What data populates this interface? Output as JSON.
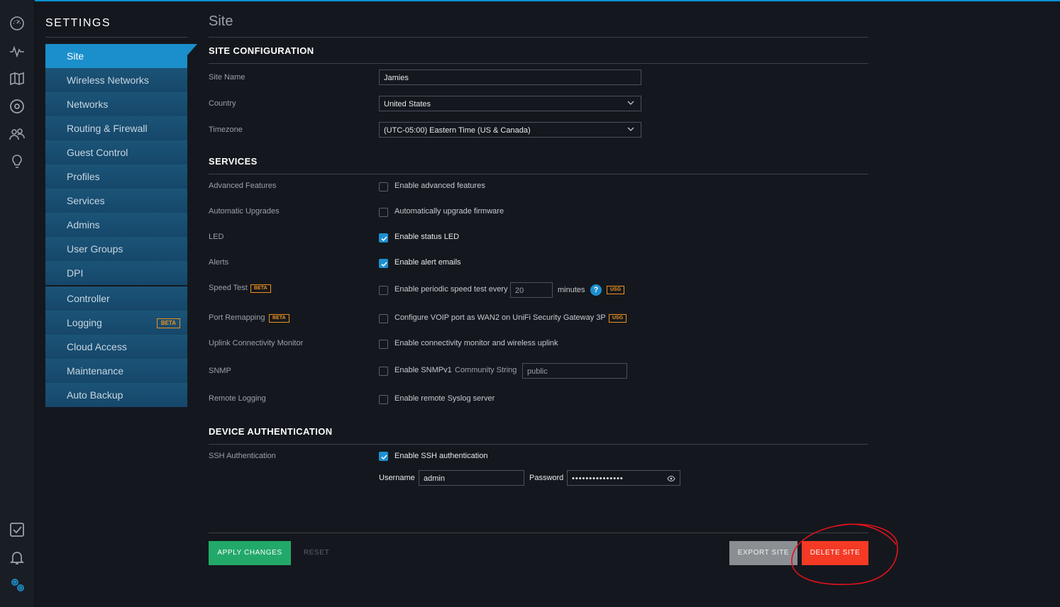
{
  "colors": {
    "accent": "#1a8fcb",
    "apply": "#22a96a",
    "delete": "#f43a25",
    "export": "#8b8e93",
    "beta": "#f0901e"
  },
  "rail": {
    "top_icons": [
      "dashboard-icon",
      "statistics-icon",
      "map-icon",
      "devices-icon",
      "clients-icon",
      "insights-icon"
    ],
    "bottom_icons": [
      "tasks-icon",
      "alerts-bell-icon",
      "settings-gears-icon"
    ]
  },
  "sidebar": {
    "title": "SETTINGS",
    "items": [
      {
        "label": "Site"
      },
      {
        "label": "Wireless Networks"
      },
      {
        "label": "Networks"
      },
      {
        "label": "Routing & Firewall"
      },
      {
        "label": "Guest Control"
      },
      {
        "label": "Profiles"
      },
      {
        "label": "Services"
      },
      {
        "label": "Admins"
      },
      {
        "label": "User Groups"
      },
      {
        "label": "DPI"
      }
    ],
    "items2": [
      {
        "label": "Controller"
      },
      {
        "label": "Logging",
        "badge": "BETA"
      },
      {
        "label": "Cloud Access"
      },
      {
        "label": "Maintenance"
      },
      {
        "label": "Auto Backup"
      }
    ]
  },
  "main": {
    "title": "Site",
    "site_config": {
      "heading": "SITE CONFIGURATION",
      "site_name_label": "Site Name",
      "site_name_value": "Jamies",
      "country_label": "Country",
      "country_value": "United States",
      "timezone_label": "Timezone",
      "timezone_value": "(UTC-05:00) Eastern Time (US & Canada)"
    },
    "services": {
      "heading": "SERVICES",
      "advanced_label": "Advanced Features",
      "advanced_opt": "Enable advanced features",
      "upgrades_label": "Automatic Upgrades",
      "upgrades_opt": "Automatically upgrade firmware",
      "led_label": "LED",
      "led_opt": "Enable status LED",
      "alerts_label": "Alerts",
      "alerts_opt": "Enable alert emails",
      "speed_label": "Speed Test",
      "speed_badge": "BETA",
      "speed_opt": "Enable periodic speed test every",
      "speed_value": "20",
      "speed_unit": "minutes",
      "help_glyph": "?",
      "usg_badge": "USG",
      "port_label": "Port Remapping",
      "port_badge": "BETA",
      "port_opt": "Configure VOIP port as WAN2 on UniFi Security Gateway 3P",
      "uplink_label": "Uplink Connectivity Monitor",
      "uplink_opt": "Enable connectivity monitor and wireless uplink",
      "snmp_label": "SNMP",
      "snmp_opt": "Enable SNMPv1",
      "snmp_community_label": "Community String",
      "snmp_community_value": "public",
      "remote_label": "Remote Logging",
      "remote_opt": "Enable remote Syslog server"
    },
    "device_auth": {
      "heading": "DEVICE AUTHENTICATION",
      "ssh_label": "SSH Authentication",
      "ssh_opt": "Enable SSH authentication",
      "username_label": "Username",
      "username_value": "admin",
      "password_label": "Password",
      "password_value": "•••••••••••••••"
    },
    "footer": {
      "apply": "APPLY CHANGES",
      "reset": "RESET",
      "export": "EXPORT SITE",
      "delete": "DELETE SITE"
    }
  }
}
